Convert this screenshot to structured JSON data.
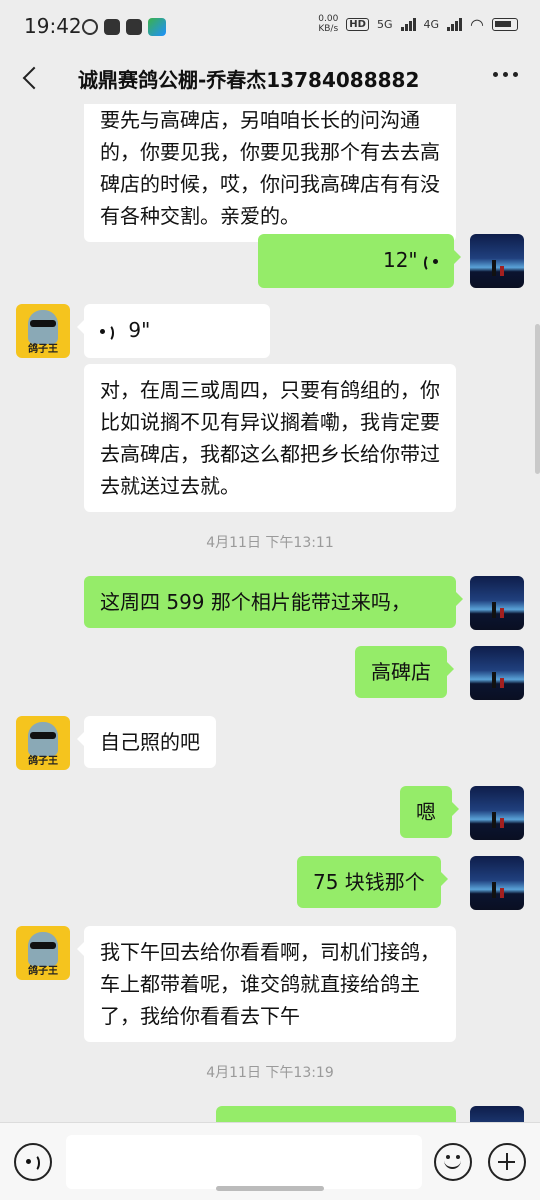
{
  "status_bar": {
    "time": "19:42",
    "speed_value": "0.00",
    "speed_unit": "KB/s",
    "hd": "HD",
    "net1": "5G",
    "net2": "4G"
  },
  "header": {
    "title": "诚鼎赛鸽公棚-乔春杰13784088882"
  },
  "avatars": {
    "contact_label": "鸽子王"
  },
  "messages": {
    "m0": "要先与高碑店，另咱咱长长的问沟通的，你要见我，你要见我那个有去去高碑店的时候，哎，你问我高碑店有有没有各种交割。亲爱的。",
    "m1_duration": "12\"",
    "m2_duration": "9\"",
    "m3": "对，在周三或周四，只要有鸽组的，你比如说搁不见有异议搁着嘞，我肯定要去高碑店，我都这么都把乡长给你带过去就送过去就。",
    "ts1": "4月11日 下午13:11",
    "m4": "这周四 599 那个相片能带过来吗，",
    "m5": "高碑店",
    "m6": "自己照的吧",
    "m7": "嗯",
    "m8": "75 块钱那个",
    "m9": "我下午回去给你看看啊，司机们接鸽，车上都带着呢，谁交鸽就直接给鸽主了，我给你看看去下午",
    "ts2": "4月11日 下午13:19"
  },
  "colors": {
    "self_bubble": "#95ec69",
    "other_bubble": "#ffffff",
    "background": "#ededed"
  }
}
